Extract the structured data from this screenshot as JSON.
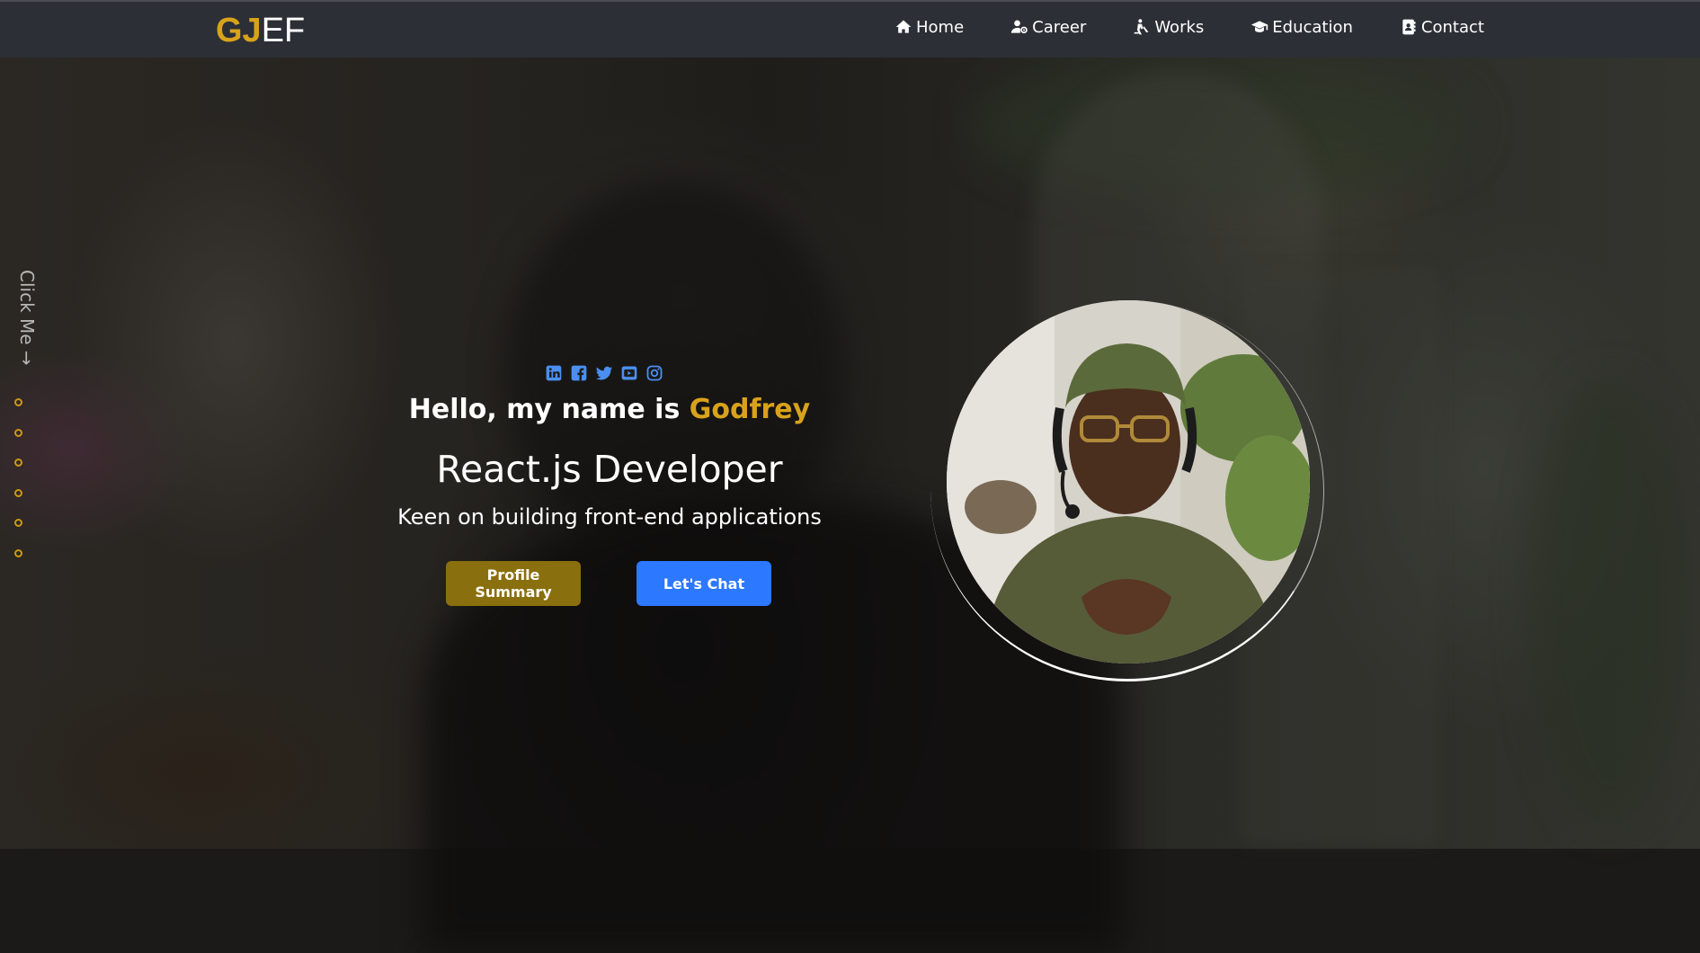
{
  "brand": {
    "logo_gold": "GJ",
    "logo_white": "EF"
  },
  "nav": {
    "items": [
      {
        "label": "Home",
        "icon": "home-icon"
      },
      {
        "label": "Career",
        "icon": "user-gear-icon"
      },
      {
        "label": "Works",
        "icon": "person-digging-icon"
      },
      {
        "label": "Education",
        "icon": "graduation-cap-icon"
      },
      {
        "label": "Contact",
        "icon": "address-book-icon"
      }
    ]
  },
  "side": {
    "click_me": "Click Me →",
    "dot_count": 6,
    "dot_color": "#c99a15"
  },
  "hero": {
    "socials": [
      {
        "name": "linkedin-icon"
      },
      {
        "name": "facebook-icon"
      },
      {
        "name": "twitter-icon"
      },
      {
        "name": "youtube-icon"
      },
      {
        "name": "instagram-icon"
      }
    ],
    "greeting_prefix": "Hello, my name is ",
    "greeting_name": "Godfrey",
    "role": "React.js Developer",
    "tagline": "Keen on building front-end applications",
    "buttons": {
      "profile": "Profile Summary",
      "chat": "Let's Chat"
    }
  },
  "colors": {
    "accent_gold": "#d9a21b",
    "button_gold": "#8a6f0e",
    "button_blue": "#2c78ff",
    "social_blue": "#4a8ff0",
    "header_bg": "#2d2f36"
  }
}
